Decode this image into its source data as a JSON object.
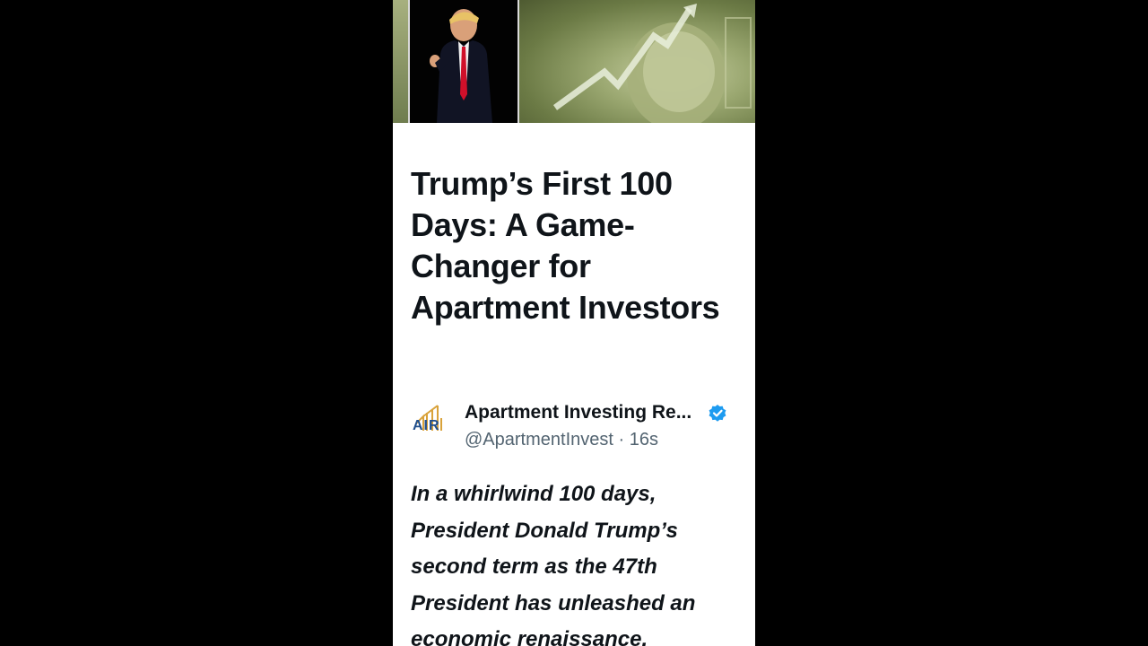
{
  "header_image": {
    "description_icon": "photo-collage"
  },
  "article": {
    "title": "Trump’s First 100 Days: A Game-Changer for Apartment Investors",
    "author": {
      "display_name": "Apartment Investing Re...",
      "handle": "@ApartmentInvest",
      "separator": "·",
      "time": "16s",
      "logo_text": "AIR",
      "verified": true
    },
    "body": "In a whirlwind 100 days, President Donald Trump’s second term as the 47th President has unleashed an economic renaissance,"
  },
  "colors": {
    "background": "#000000",
    "card": "#ffffff",
    "text_primary": "#0f1419",
    "text_secondary": "#536471",
    "verified_blue": "#1d9bf0",
    "logo_blue": "#1f4e8c",
    "logo_gold": "#d9a23a"
  }
}
